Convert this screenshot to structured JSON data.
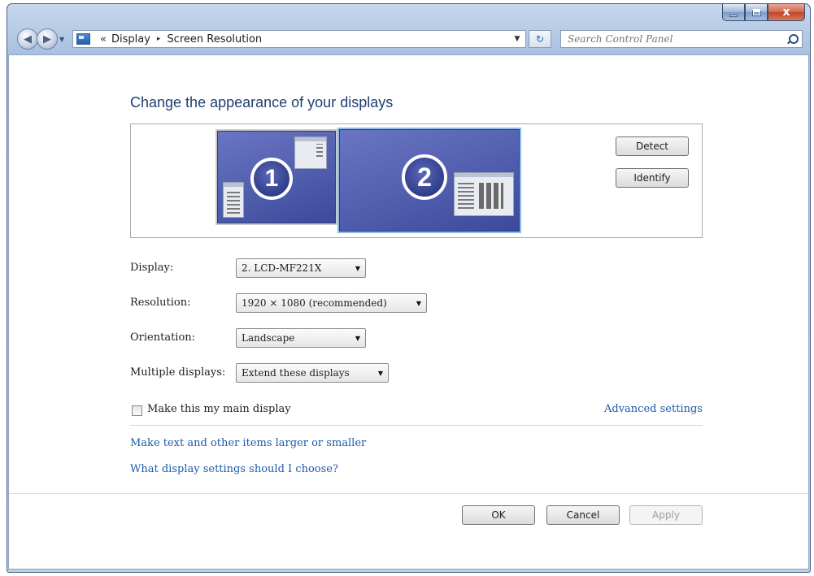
{
  "window": {
    "close_glyph": "x"
  },
  "navbar": {
    "breadcrumb_prefix": "«",
    "breadcrumb_arrow": "▸",
    "breadcrumbs": [
      "Display",
      "Screen Resolution"
    ],
    "search_placeholder": "Search Control Panel"
  },
  "main": {
    "title": "Change the appearance of your displays",
    "monitors": [
      {
        "number": "1"
      },
      {
        "number": "2"
      }
    ],
    "detect_label": "Detect",
    "identify_label": "Identify",
    "display": {
      "label": "Display:",
      "value": "2. LCD-MF221X"
    },
    "resolution": {
      "label": "Resolution:",
      "value": "1920 × 1080 (recommended)"
    },
    "orientation": {
      "label": "Orientation:",
      "value": "Landscape"
    },
    "multiple_displays": {
      "label": "Multiple displays:",
      "value": "Extend these displays"
    },
    "main_display_checkbox": {
      "label": "Make this my main display",
      "checked": false
    },
    "advanced_settings_link": "Advanced settings",
    "text_size_link": "Make text and other items larger or smaller",
    "help_link": "What display settings should I choose?"
  },
  "footer": {
    "ok_label": "OK",
    "cancel_label": "Cancel",
    "apply_label": "Apply"
  },
  "colors": {
    "title": "#1f3f72",
    "link": "#1c5aa8",
    "monitor_fill": "#4a58a8"
  }
}
